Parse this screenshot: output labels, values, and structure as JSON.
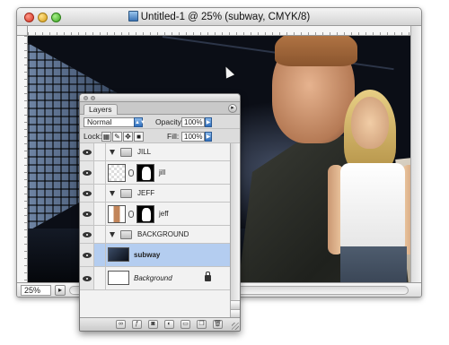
{
  "document": {
    "title": "Untitled-1 @ 25% (subway, CMYK/8)",
    "zoom": "25%"
  },
  "layers_panel": {
    "tab_label": "Layers",
    "blend_mode": "Normal",
    "opacity_label": "Opacity:",
    "opacity_value": "100%",
    "lock_label": "Lock:",
    "fill_label": "Fill:",
    "fill_value": "100%",
    "layers": [
      {
        "type": "group",
        "name": "JILL",
        "visible": true,
        "expanded": true
      },
      {
        "type": "layer",
        "name": "jill",
        "visible": true,
        "has_mask": true,
        "thumb": "checker"
      },
      {
        "type": "group",
        "name": "JEFF",
        "visible": true,
        "expanded": true
      },
      {
        "type": "layer",
        "name": "jeff",
        "visible": true,
        "has_mask": true,
        "thumb": "person"
      },
      {
        "type": "group",
        "name": "BACKGROUND",
        "visible": true,
        "expanded": true
      },
      {
        "type": "layer",
        "name": "subway",
        "visible": true,
        "selected": true,
        "thumb": "subway"
      },
      {
        "type": "layer",
        "name": "Background",
        "visible": true,
        "locked": true,
        "thumb": "white"
      }
    ],
    "bottom_icons": [
      "link-icon",
      "layer-style-icon",
      "add-mask-icon",
      "adjustment-layer-icon",
      "new-group-icon",
      "new-layer-icon",
      "trash-icon"
    ]
  },
  "colors": {
    "selection": "#b4cdf0",
    "arrow_blue": "#2f6fbf"
  }
}
